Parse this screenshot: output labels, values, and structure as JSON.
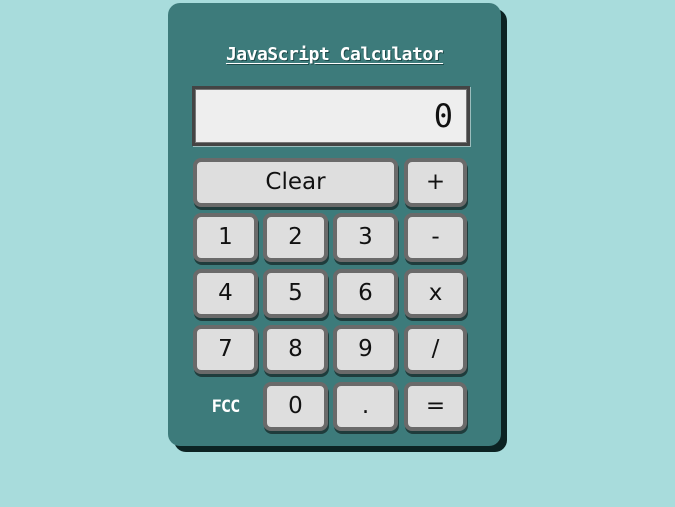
{
  "title": "JavaScript Calculator",
  "display": {
    "value": "0"
  },
  "keys": {
    "clear": "Clear",
    "plus": "+",
    "one": "1",
    "two": "2",
    "three": "3",
    "minus": "-",
    "four": "4",
    "five": "5",
    "six": "6",
    "multiply": "x",
    "seven": "7",
    "eight": "8",
    "nine": "9",
    "divide": "/",
    "zero": "0",
    "decimal": ".",
    "equals": "="
  },
  "brand": "FCC",
  "colors": {
    "page_background": "#a8dcdc",
    "calculator_body": "#3d7b7b",
    "key_face": "#dedede",
    "key_border": "#6a6a6a",
    "display_background": "#eeeeee"
  }
}
